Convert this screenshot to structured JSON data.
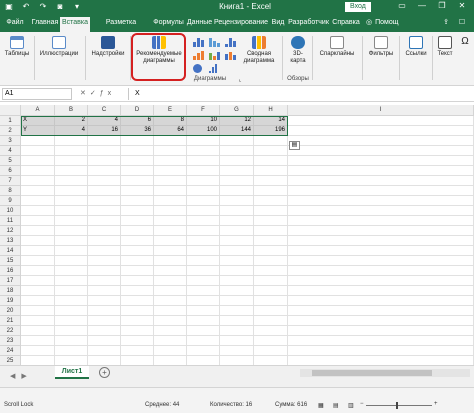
{
  "window": {
    "title": "Книга1 - Excel",
    "signin": "Вход",
    "qat_icons": [
      "save-icon",
      "undo-icon",
      "redo-icon",
      "camera-icon",
      "customize-icon"
    ],
    "controls": [
      "—",
      "❐",
      "✕"
    ]
  },
  "tabs": [
    {
      "label": "Файл"
    },
    {
      "label": "Главная"
    },
    {
      "label": "Вставка",
      "active": true
    },
    {
      "label": "Разметка страницы"
    },
    {
      "label": "Формулы"
    },
    {
      "label": "Данные"
    },
    {
      "label": "Рецензирование"
    },
    {
      "label": "Вид"
    },
    {
      "label": "Разработчик"
    },
    {
      "label": "Справка"
    },
    {
      "label": "Помощ"
    }
  ],
  "ribbon": {
    "groups": [
      {
        "label": "Таблицы",
        "icon": "table-icon"
      },
      {
        "label": "Иллюстрации",
        "icon": "illustrations-icon"
      },
      {
        "label": "Надстройки",
        "icon": "addins-icon"
      },
      {
        "label": "Рекомендуемые диаграммы",
        "icon": "recommended-charts-icon"
      },
      {
        "label": "Сводная диаграмма",
        "icon": "pivot-chart-icon"
      },
      {
        "label": "3D-карта",
        "icon": "map-3d-icon"
      },
      {
        "label": "Спарклайны",
        "icon": "sparklines-icon"
      },
      {
        "label": "Фильтры",
        "icon": "filter-icon"
      },
      {
        "label": "Ссылки",
        "icon": "link-icon"
      },
      {
        "label": "Текст",
        "icon": "text-icon"
      }
    ],
    "group_names": {
      "charts": "Диаграммы",
      "tours": "Обзоры"
    },
    "recommended_line1": "Рекомендуемые",
    "recommended_line2": "диаграммы",
    "pivot_line1": "Сводная",
    "pivot_line2": "диаграмма",
    "map_line1": "3D-",
    "map_line2": "карта"
  },
  "formula_bar": {
    "name_box": "A1",
    "value": "X"
  },
  "grid": {
    "columns": [
      "A",
      "B",
      "C",
      "D",
      "E",
      "F",
      "G",
      "H",
      "I"
    ],
    "rows": [
      "1",
      "2",
      "3",
      "4",
      "5",
      "6",
      "7",
      "8",
      "9",
      "10",
      "11",
      "12",
      "13",
      "14",
      "15",
      "16",
      "17",
      "18",
      "19",
      "20",
      "21",
      "22",
      "23",
      "24",
      "25"
    ],
    "data": [
      [
        "X",
        "2",
        "4",
        "6",
        "8",
        "10",
        "12",
        "14"
      ],
      [
        "Y",
        "4",
        "16",
        "36",
        "64",
        "100",
        "144",
        "196"
      ]
    ]
  },
  "sheets": {
    "active": "Лист1",
    "add": "+"
  },
  "status": {
    "mode": "Scroll Lock",
    "average": "Среднее: 44",
    "count": "Количество: 16",
    "sum": "Сумма: 616"
  }
}
